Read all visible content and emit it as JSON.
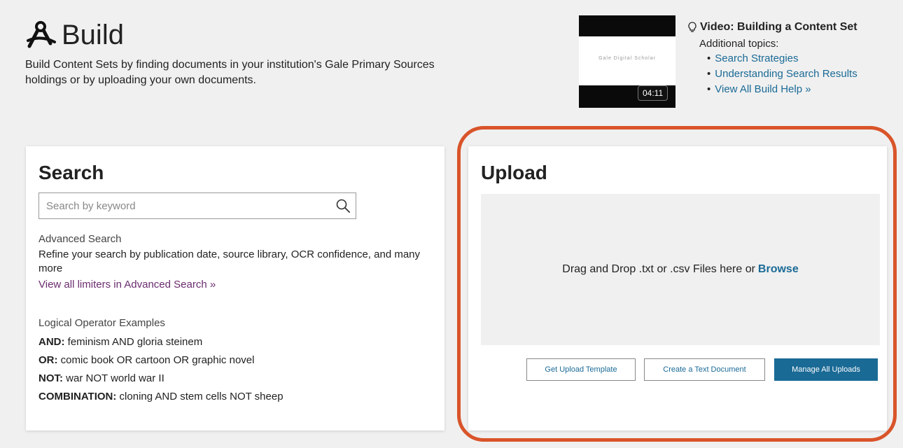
{
  "header": {
    "title": "Build",
    "icon": "build-tools-icon",
    "description": "Build Content Sets by finding documents in your institution's Gale Primary Sources holdings or by uploading your own documents."
  },
  "video": {
    "duration": "04:11",
    "thumbnail_text": "Gale   Digital   Scholar",
    "title": "Video: Building a Content Set"
  },
  "help": {
    "subtitle": "Additional topics:",
    "links": [
      "Search Strategies",
      "Understanding Search Results",
      "View All Build Help »"
    ]
  },
  "search": {
    "title": "Search",
    "placeholder": "Search by keyword",
    "advanced_heading": "Advanced Search",
    "advanced_desc": "Refine your search by publication date, source library, OCR confidence, and many more",
    "advanced_link": "View all limiters in Advanced Search »",
    "logic_heading": "Logical Operator Examples",
    "examples": [
      {
        "op": "AND:",
        "text": "feminism AND gloria steinem"
      },
      {
        "op": "OR:",
        "text": "comic book OR cartoon OR graphic novel"
      },
      {
        "op": "NOT:",
        "text": "war NOT world war II"
      },
      {
        "op": "COMBINATION:",
        "text": "cloning AND stem cells NOT sheep"
      }
    ]
  },
  "upload": {
    "title": "Upload",
    "drop_text": "Drag and Drop .txt or .csv Files here or",
    "browse_label": "Browse",
    "buttons": {
      "template": "Get Upload Template",
      "textdoc": "Create a Text Document",
      "manage": "Manage All Uploads"
    }
  },
  "colors": {
    "accent": "#1a6a96",
    "highlight": "#d9542a",
    "visited_link": "#6a2c6e"
  }
}
